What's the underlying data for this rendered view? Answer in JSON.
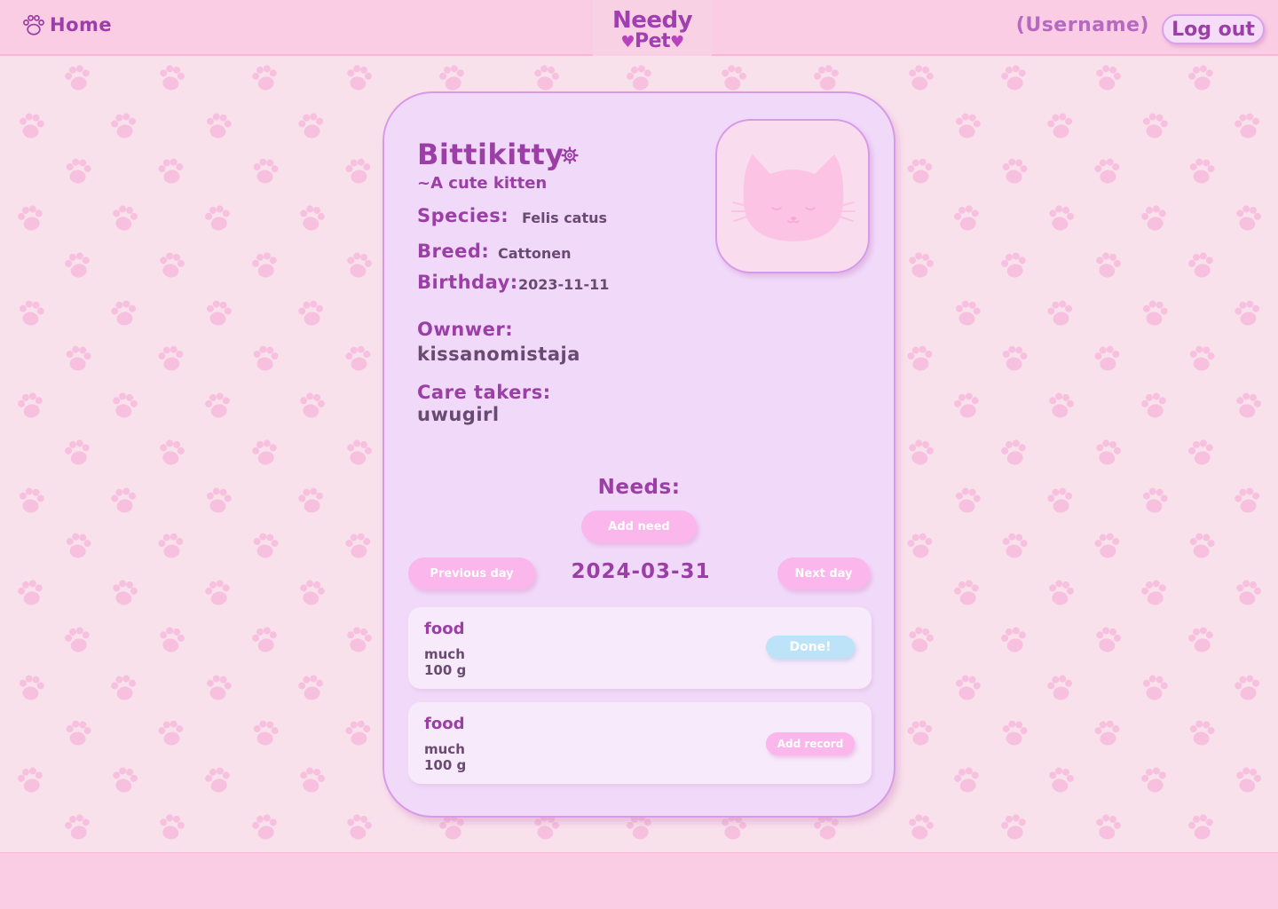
{
  "header": {
    "home_label": "Home",
    "logo_line1": "Needy",
    "logo_line2": "Pet",
    "username": "(Username)",
    "logout_label": "Log out"
  },
  "pet": {
    "name": "Bittikitty",
    "tagline": "~A cute kitten",
    "species_label": "Species:",
    "species": "Felis catus",
    "breed_label": "Breed:",
    "breed": "Cattonen",
    "birthday_label": "Birthday:",
    "birthday": "2023-11-11",
    "owner_label": "Ownwer:",
    "owner": "kissanomistaja",
    "caretakers_label": "Care takers:",
    "caretakers": "uwugirl"
  },
  "needs": {
    "title": "Needs:",
    "add_need_label": "Add need",
    "prev_day_label": "Previous day",
    "next_day_label": "Next day",
    "current_date": "2024-03-31",
    "items": [
      {
        "title": "food",
        "amount_line1": "much",
        "amount_line2": "100 g",
        "action_label": "Done!"
      },
      {
        "title": "food",
        "amount_line1": "much",
        "amount_line2": "100 g",
        "action_label": "Add record"
      }
    ]
  },
  "icons": {
    "home": "paw-icon",
    "settings": "gear-icon",
    "avatar": "cat-face-icon",
    "background": "paw-icon"
  },
  "colors": {
    "header_bg": "#fbcde4",
    "page_bg": "#f9e1ec",
    "paw": "#f7c0df",
    "card_bg": "#f1daf9",
    "card_border": "#d89ae8",
    "accent_text": "#9b3fa7",
    "body_text": "#6a4a72",
    "pink_button": "#fbb6eb",
    "done_button": "#bde3f8"
  }
}
